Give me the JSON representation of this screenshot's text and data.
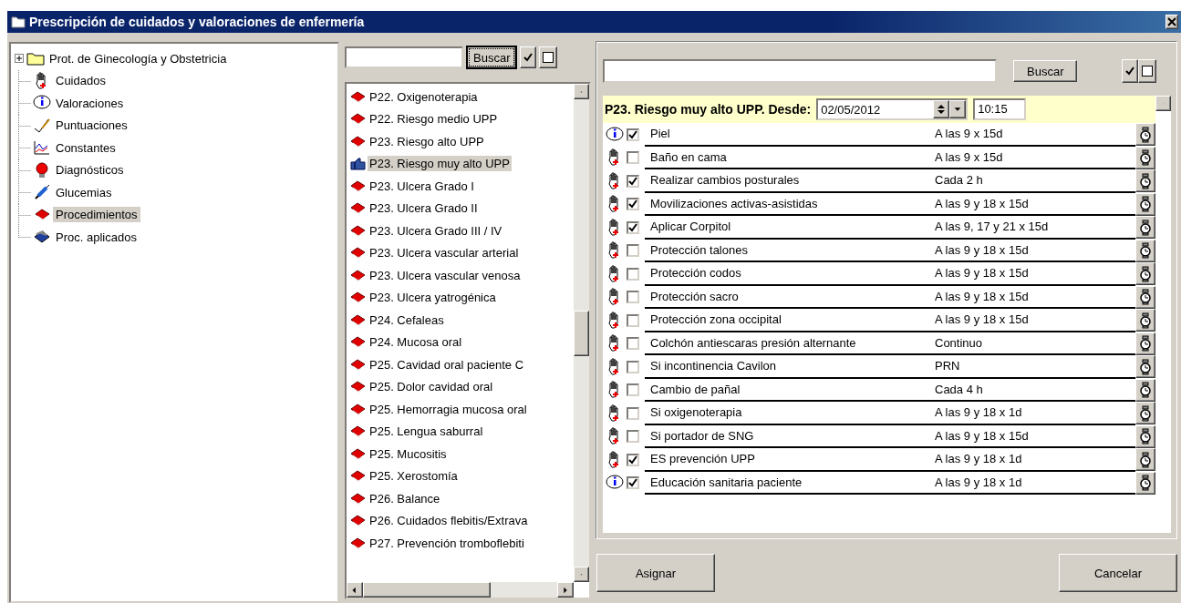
{
  "window": {
    "title": "Prescripción de cuidados y valoraciones de enfermería"
  },
  "tree": {
    "items": [
      {
        "label": "Prot. de Ginecología y Obstetricia",
        "kind": "folder",
        "expanded": false,
        "selected": false
      },
      {
        "label": "Cuidados",
        "kind": "care",
        "selected": false
      },
      {
        "label": "Valoraciones",
        "kind": "info",
        "selected": false
      },
      {
        "label": "Puntuaciones",
        "kind": "score",
        "selected": false
      },
      {
        "label": "Constantes",
        "kind": "chart",
        "selected": false
      },
      {
        "label": "Diagnósticos",
        "kind": "bulb",
        "selected": false
      },
      {
        "label": "Glucemias",
        "kind": "syringe",
        "selected": false
      },
      {
        "label": "Procedimientos",
        "kind": "book",
        "selected": true
      },
      {
        "label": "Proc. aplicados",
        "kind": "applied",
        "selected": false
      }
    ]
  },
  "procedures": {
    "search_button": "Buscar",
    "items": [
      {
        "label": "P22. Oxigenoterapia",
        "selected": false
      },
      {
        "label": "P22. Riesgo medio UPP",
        "selected": false
      },
      {
        "label": "P23. Riesgo alto UPP",
        "selected": false
      },
      {
        "label": "P23. Riesgo muy alto UPP",
        "selected": true
      },
      {
        "label": "P23. Ulcera Grado I",
        "selected": false
      },
      {
        "label": "P23. Ulcera Grado II",
        "selected": false
      },
      {
        "label": "P23. Ulcera Grado III / IV",
        "selected": false
      },
      {
        "label": "P23. Ulcera vascular arterial",
        "selected": false
      },
      {
        "label": "P23. Ulcera vascular venosa",
        "selected": false
      },
      {
        "label": "P23. Ulcera yatrogénica",
        "selected": false
      },
      {
        "label": "P24. Cefaleas",
        "selected": false
      },
      {
        "label": "P24. Mucosa oral",
        "selected": false
      },
      {
        "label": "P25. Cavidad oral paciente C",
        "selected": false
      },
      {
        "label": "P25. Dolor cavidad oral",
        "selected": false
      },
      {
        "label": "P25. Hemorragia mucosa oral",
        "selected": false
      },
      {
        "label": "P25. Lengua saburral",
        "selected": false
      },
      {
        "label": "P25. Mucositis",
        "selected": false
      },
      {
        "label": "P25. Xerostomía",
        "selected": false
      },
      {
        "label": "P26. Balance",
        "selected": false
      },
      {
        "label": "P26. Cuidados flebitis/Extrava",
        "selected": false
      },
      {
        "label": "P27. Prevención tromboflebiti",
        "selected": false
      }
    ]
  },
  "detail": {
    "search_button": "Buscar",
    "header": "P23. Riesgo muy alto UPP. Desde:",
    "date": "02/05/2012",
    "time": "10:15",
    "rows": [
      {
        "kind": "info",
        "checked": true,
        "name": "Piel",
        "schedule": "A las 9 x 15d"
      },
      {
        "kind": "care",
        "checked": false,
        "name": "Baño en cama",
        "schedule": "A las 9 x 15d"
      },
      {
        "kind": "care",
        "checked": true,
        "name": "Realizar cambios posturales",
        "schedule": "Cada 2 h"
      },
      {
        "kind": "care",
        "checked": true,
        "name": "Movilizaciones activas-asistidas",
        "schedule": "A las 9 y 18 x 15d"
      },
      {
        "kind": "care",
        "checked": true,
        "name": "Aplicar Corpitol",
        "schedule": "A las 9, 17 y 21 x 15d"
      },
      {
        "kind": "care",
        "checked": false,
        "name": "Protección talones",
        "schedule": "A las 9 y 18 x 15d"
      },
      {
        "kind": "care",
        "checked": false,
        "name": "Protección codos",
        "schedule": "A las 9 y 18 x 15d"
      },
      {
        "kind": "care",
        "checked": false,
        "name": "Protección sacro",
        "schedule": "A las 9 y 18 x 15d"
      },
      {
        "kind": "care",
        "checked": false,
        "name": "Protección zona occipital",
        "schedule": "A las 9 y 18 x 15d"
      },
      {
        "kind": "care",
        "checked": false,
        "name": "Colchón antiescaras presión alternante",
        "schedule": "Continuo"
      },
      {
        "kind": "care",
        "checked": false,
        "name": "Si incontinencia Cavilon",
        "schedule": "PRN"
      },
      {
        "kind": "care",
        "checked": false,
        "name": "Cambio de pañal",
        "schedule": "Cada 4 h"
      },
      {
        "kind": "care",
        "checked": false,
        "name": "Si oxigenoterapia",
        "schedule": "A las 9 y 18 x 1d"
      },
      {
        "kind": "care",
        "checked": false,
        "name": "Si portador de SNG",
        "schedule": "A las 9 y 18 x 15d"
      },
      {
        "kind": "care",
        "checked": true,
        "name": "ES prevención UPP",
        "schedule": "A las 9 y 18 x 1d"
      },
      {
        "kind": "info",
        "checked": true,
        "name": "Educación sanitaria paciente",
        "schedule": "A las 9 y 18 x 1d"
      }
    ]
  },
  "buttons": {
    "assign": "Asignar",
    "cancel": "Cancelar"
  }
}
